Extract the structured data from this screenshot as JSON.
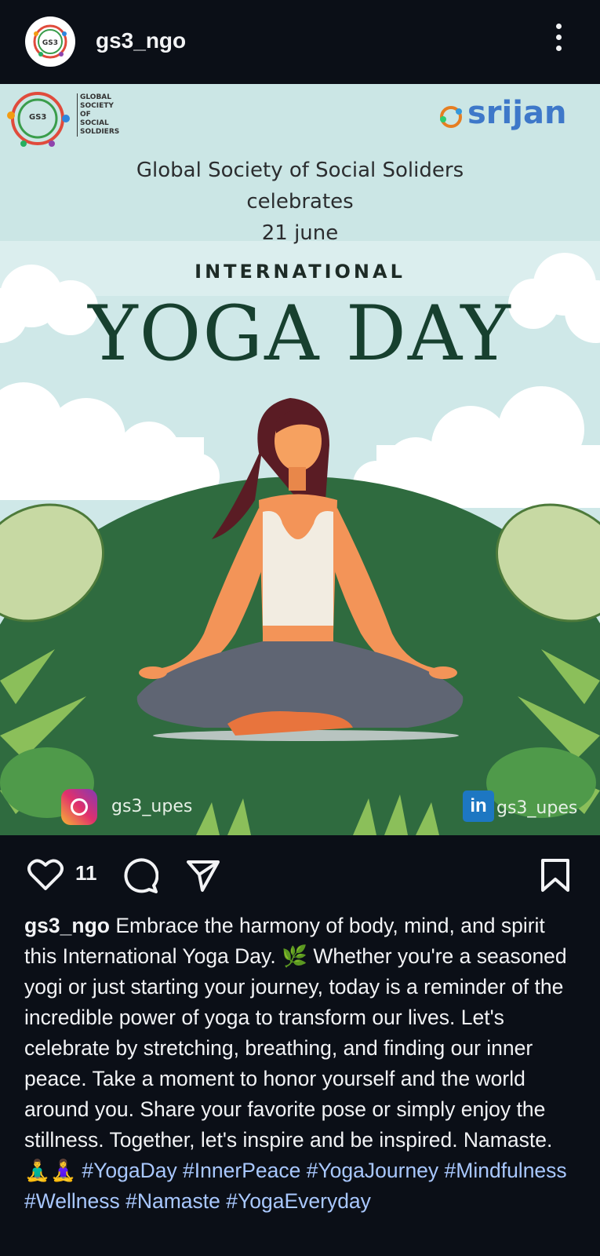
{
  "header": {
    "username": "gs3_ngo"
  },
  "poster": {
    "org_lines": [
      "GLOBAL",
      "SOCIETY",
      "OF",
      "SOCIAL",
      "SOLDIERS"
    ],
    "logo_label": "GS3",
    "partner": "srijan",
    "line1": "Global Society of Social Soliders",
    "line2": "celebrates",
    "line3": "21 june",
    "subtitle": "INTERNATIONAL",
    "title": "YOGA DAY",
    "instagram_handle": "gs3_upes",
    "linkedin_handle": "gs3_upes",
    "linkedin_glyph": "in"
  },
  "actions": {
    "like_count": "11",
    "icons": [
      "heart-icon",
      "comment-icon",
      "share-icon",
      "bookmark-icon"
    ]
  },
  "caption": {
    "username": "gs3_ngo",
    "text": "Embrace the harmony of body, mind, and spirit this International Yoga Day. 🌿 Whether you're a seasoned yogi or just starting your journey, today is a reminder of the incredible power of yoga to transform our lives. Let's celebrate by stretching, breathing, and finding our inner peace. Take a moment to honor yourself and the world around you. Share your favorite pose or simply enjoy the stillness. Together, let's inspire and be inspired. Namaste. 🧘‍♂️🧘‍♀️",
    "hashtags": "#YogaDay #InnerPeace #YogaJourney #Mindfulness #Wellness #Namaste #YogaEveryday"
  },
  "colors": {
    "background": "#0b0f17",
    "hashtag": "#a9c8ff",
    "title_green": "#17402f",
    "hill_green": "#2f6b3f"
  }
}
